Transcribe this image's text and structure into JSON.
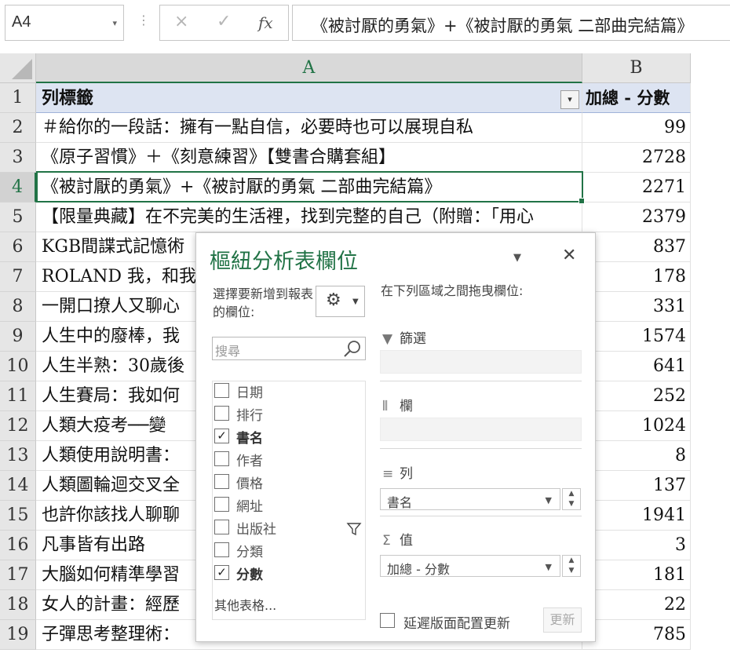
{
  "formula_bar": {
    "name_box": "A4",
    "cancel_icon": "×",
    "enter_icon": "✓",
    "fx_label": "fx",
    "content": "《被討厭的勇氣》+《被討厭的勇氣 二部曲完結篇》"
  },
  "columns": [
    "A",
    "B"
  ],
  "rows": [
    {
      "num": "1",
      "a": "列標籤",
      "b": "加總 - 分數"
    },
    {
      "num": "2",
      "a": "＃給你的一段話：擁有一點自信，必要時也可以展現自私",
      "b": "99"
    },
    {
      "num": "3",
      "a": "《原子習慣》＋《刻意練習》【雙書合購套組】",
      "b": "2728"
    },
    {
      "num": "4",
      "a": "《被討厭的勇氣》+《被討厭的勇氣 二部曲完結篇》",
      "b": "2271"
    },
    {
      "num": "5",
      "a": "【限量典藏】在不完美的生活裡，找到完整的自己（附贈：「用心",
      "b": "2379"
    },
    {
      "num": "6",
      "a": "KGB間諜式記憶術",
      "b": "837"
    },
    {
      "num": "7",
      "a": "ROLAND 我，和我",
      "b": "178"
    },
    {
      "num": "8",
      "a": "一開口撩人又聊心",
      "b": "331"
    },
    {
      "num": "9",
      "a": "人生中的廢棒，我",
      "b": "1574"
    },
    {
      "num": "10",
      "a": "人生半熟：30歲後",
      "b": "641"
    },
    {
      "num": "11",
      "a": "人生賽局：我如何",
      "b": "252"
    },
    {
      "num": "12",
      "a": "人類大疫考──變",
      "b": "1024"
    },
    {
      "num": "13",
      "a": "人類使用說明書：",
      "b": "8"
    },
    {
      "num": "14",
      "a": "人類圖輪迴交叉全",
      "b": "137"
    },
    {
      "num": "15",
      "a": "也許你該找人聊聊",
      "b": "1941"
    },
    {
      "num": "16",
      "a": "凡事皆有出路",
      "b": "3"
    },
    {
      "num": "17",
      "a": "大腦如何精準學習",
      "b": "181"
    },
    {
      "num": "18",
      "a": "女人的計畫：經歷",
      "b": "22"
    },
    {
      "num": "19",
      "a": "子彈思考整理術：",
      "b": "785"
    }
  ],
  "pivot_panel": {
    "title": "樞紐分析表欄位",
    "choose_label": "選擇要新增到報表的欄位:",
    "drag_label": "在下列區域之間拖曳欄位:",
    "search_placeholder": "搜尋",
    "fields": [
      {
        "label": "日期",
        "checked": false
      },
      {
        "label": "排行",
        "checked": false
      },
      {
        "label": "書名",
        "checked": true
      },
      {
        "label": "作者",
        "checked": false
      },
      {
        "label": "價格",
        "checked": false
      },
      {
        "label": "網址",
        "checked": false
      },
      {
        "label": "出版社",
        "checked": false
      },
      {
        "label": "分類",
        "checked": false
      },
      {
        "label": "分數",
        "checked": true
      }
    ],
    "more_tables": "其他表格...",
    "areas": {
      "filters": "篩選",
      "columns": "欄",
      "rows": "列",
      "values": "值"
    },
    "rows_item": "書名",
    "values_item": "加總 - 分數",
    "defer_label": "延遲版面配置更新",
    "update_button": "更新"
  },
  "colors": {
    "accent": "#217346",
    "header_fill": "#dde4f2"
  }
}
